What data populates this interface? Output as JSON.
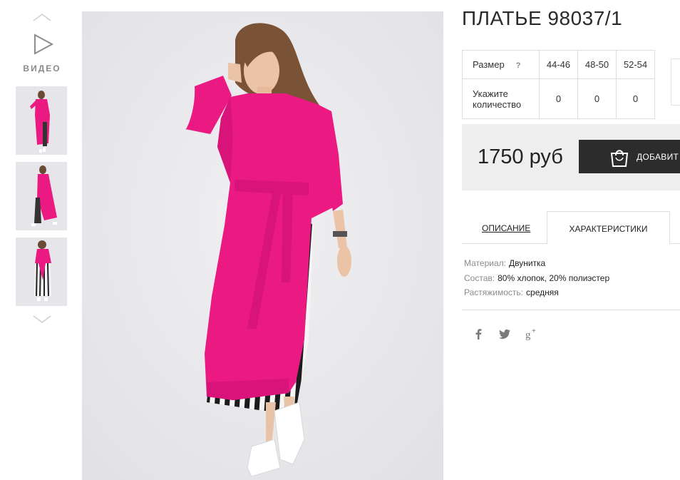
{
  "gallery": {
    "video_label": "ВИДЕО",
    "thumbnails": [
      "dress-front",
      "dress-walk",
      "dress-back"
    ]
  },
  "product": {
    "title": "ПЛАТЬЕ 98037/1",
    "size_header": "Размер",
    "size_help": "?",
    "sizes": [
      "44-46",
      "48-50",
      "52-54"
    ],
    "qty_label_line1": "Укажите",
    "qty_label_line2": "количество",
    "quantities": [
      "0",
      "0",
      "0"
    ],
    "price": "1750 руб",
    "add_button_label": "ДОБАВИТ"
  },
  "tabs": {
    "description": "ОПИСАНИЕ",
    "characteristics": "ХАРАКТЕРИСТИКИ"
  },
  "specs": [
    {
      "key": "Материал:",
      "value": "Двунитка"
    },
    {
      "key": "Состав:",
      "value": "80% хлопок, 20% полиэстер"
    },
    {
      "key": "Растяжимость:",
      "value": "средняя"
    }
  ],
  "social": [
    "facebook-icon",
    "twitter-icon",
    "google-plus-icon"
  ],
  "colors": {
    "dress": "#ea1a82",
    "button": "#2c2c2c",
    "price_bg": "#eeeeee",
    "photo_bg": "#e9e9ed"
  }
}
